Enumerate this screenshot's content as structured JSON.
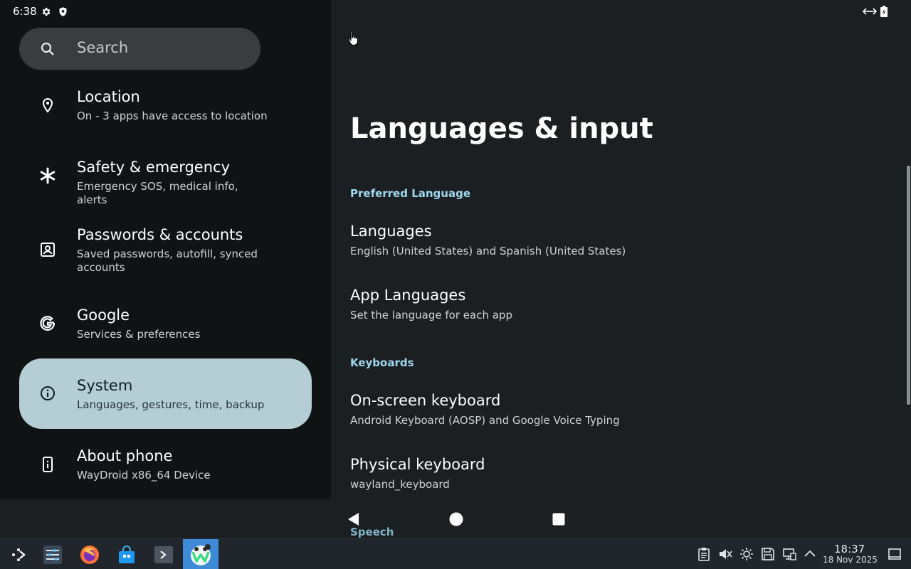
{
  "status_bar": {
    "time": "6:38",
    "icons": [
      "settings-gear-icon",
      "shield-icon",
      "data-transfer-icon",
      "battery-icon"
    ]
  },
  "search": {
    "placeholder": "Search"
  },
  "sidebar": {
    "items": [
      {
        "title": "Location",
        "subtitle": "On - 3 apps have access to location",
        "icon": "location-pin-icon"
      },
      {
        "title": "Safety & emergency",
        "subtitle": "Emergency SOS, medical info, alerts",
        "icon": "asterisk-icon"
      },
      {
        "title": "Passwords & accounts",
        "subtitle": "Saved passwords, autofill, synced accounts",
        "icon": "account-box-icon"
      },
      {
        "title": "Google",
        "subtitle": "Services & preferences",
        "icon": "google-icon"
      },
      {
        "title": "System",
        "subtitle": "Languages, gestures, time, backup",
        "icon": "info-icon",
        "selected": true
      },
      {
        "title": "About phone",
        "subtitle": "WayDroid x86_64 Device",
        "icon": "phone-info-icon"
      }
    ]
  },
  "main": {
    "title": "Languages & input",
    "sections": [
      {
        "header": "Preferred Language",
        "items": [
          {
            "title": "Languages",
            "subtitle": "English (United States) and Spanish (United States)"
          },
          {
            "title": "App Languages",
            "subtitle": "Set the language for each app"
          }
        ]
      },
      {
        "header": "Keyboards",
        "items": [
          {
            "title": "On-screen keyboard",
            "subtitle": "Android Keyboard (AOSP) and Google Voice Typing"
          },
          {
            "title": "Physical keyboard",
            "subtitle": "wayland_keyboard"
          }
        ]
      },
      {
        "header": "Speech",
        "items": []
      }
    ]
  },
  "nav_bar": {
    "buttons": [
      "back-icon",
      "home-icon",
      "recents-icon"
    ]
  },
  "taskbar": {
    "apps": [
      "app-launcher-icon",
      "system-settings-icon",
      "firefox-icon",
      "discover-store-icon",
      "terminal-icon",
      "waydroid-icon"
    ],
    "tray": [
      "clipboard-icon",
      "volume-muted-icon",
      "brightness-icon",
      "save-disk-icon",
      "network-icon",
      "tray-expand-icon"
    ],
    "clock_time": "18:37",
    "clock_date": "18 Nov 2025"
  },
  "colors": {
    "selected_bg": "#b5ced6",
    "section_header": "#9fd8ee",
    "taskbar_active": "#3d8ad6"
  }
}
